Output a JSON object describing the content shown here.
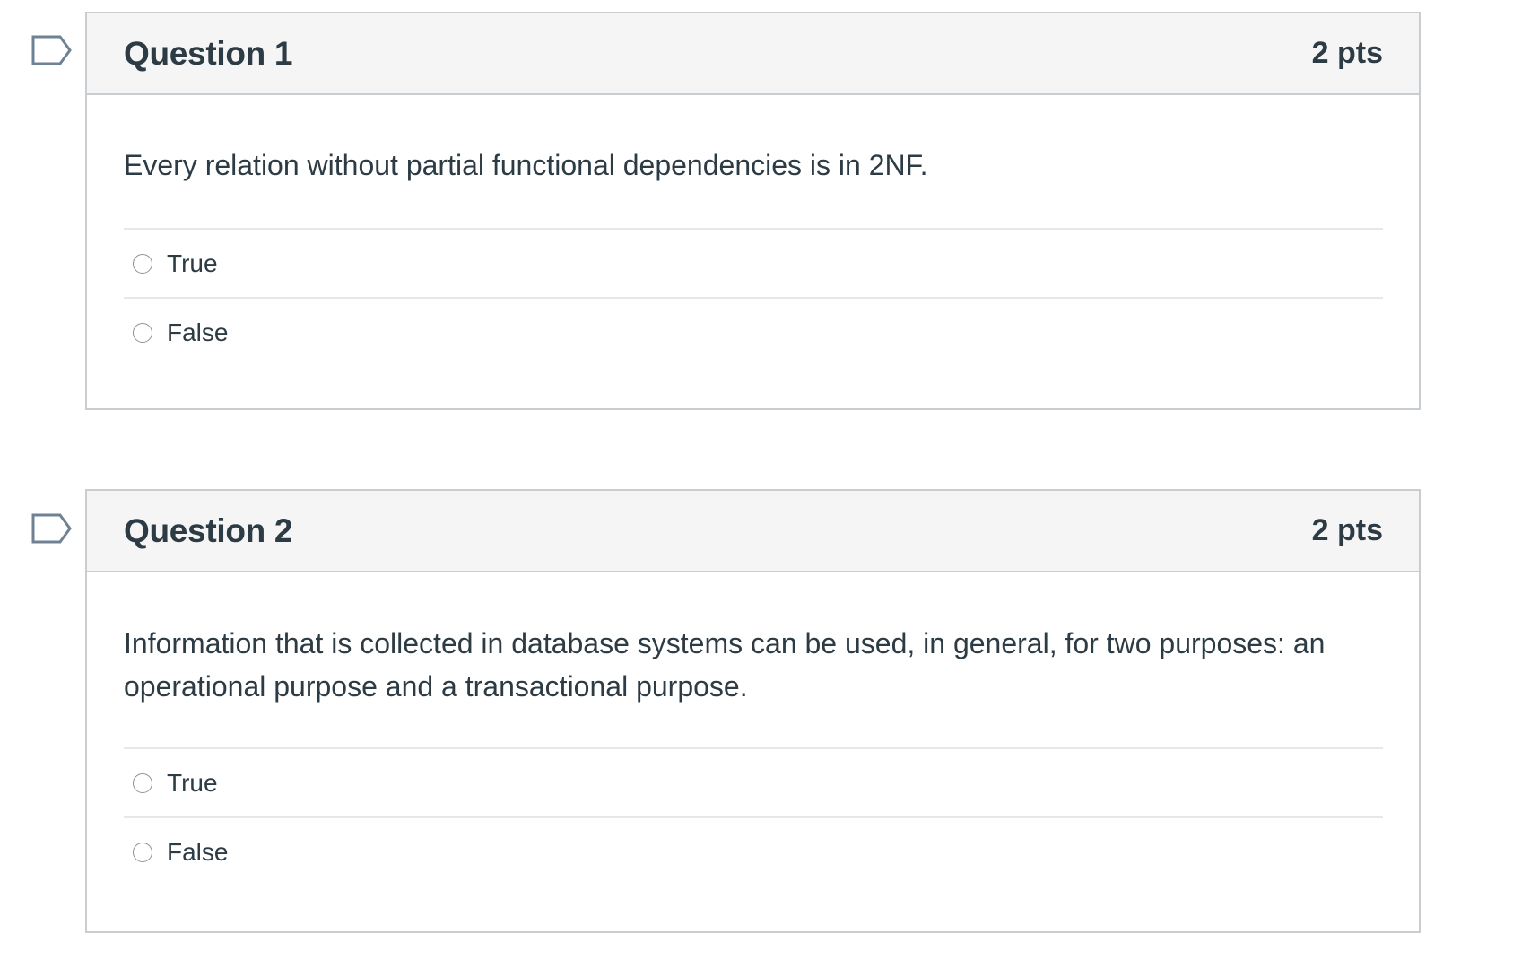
{
  "colors": {
    "text": "#2d3b45",
    "header_bg": "#f5f5f5",
    "border": "#c7cdd1",
    "divider": "#e5e7e9",
    "flag": "#6f8294"
  },
  "icons": {
    "flag": "bookmark-flag-icon",
    "radio": "radio-unselected-icon"
  },
  "questions": [
    {
      "title": "Question 1",
      "points": "2 pts",
      "text": "Every relation without partial functional dependencies is in 2NF.",
      "answers": [
        {
          "label": "True",
          "selected": false
        },
        {
          "label": "False",
          "selected": false
        }
      ]
    },
    {
      "title": "Question 2",
      "points": "2 pts",
      "text": "Information that is collected in database systems can be used, in general, for two purposes: an operational purpose and a transactional purpose.",
      "answers": [
        {
          "label": "True",
          "selected": false
        },
        {
          "label": "False",
          "selected": false
        }
      ]
    }
  ]
}
